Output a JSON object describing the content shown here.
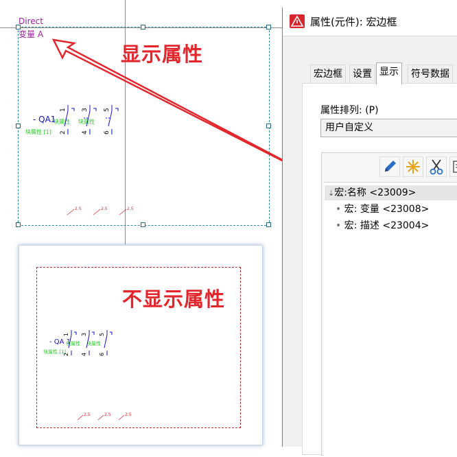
{
  "canvas": {
    "direct_label": "Direct",
    "variant_label": "变量 A",
    "annotation_show": "显示属性",
    "annotation_hide": "不显示属性",
    "device_tag": "- QA1",
    "device_tag2": "- QA 1",
    "attr_text_a": "块属性",
    "attr_text_b": "块属性",
    "attr_text_c": "块属性 [1]",
    "pin_numbers": [
      "1",
      "3",
      "5"
    ],
    "pin_numbers_bottom": [
      "2",
      "4",
      "6"
    ],
    "wire_size": "2.5"
  },
  "dialog": {
    "title": "属性(元件): 宏边框",
    "tabs": [
      {
        "label": "宏边框",
        "active": false
      },
      {
        "label": "设置",
        "active": false
      },
      {
        "label": "显示",
        "active": true
      },
      {
        "label": "符号数据",
        "active": false
      }
    ],
    "attr_order_label": "属性排列: (P)",
    "attr_order_value": "用户自定义",
    "toolbar": [
      "pencil-icon",
      "star-burst-icon",
      "scissors-icon",
      "copy-icon"
    ],
    "list": [
      {
        "text": "宏:名称 <23009>",
        "selected": true
      },
      {
        "text": "宏: 变量 <23008>",
        "selected": false
      },
      {
        "text": "宏: 描述 <23004>",
        "selected": false
      }
    ]
  },
  "colors": {
    "annotation": "#e3262c",
    "purple_text": "#a020a0",
    "blue_text": "#1010d0",
    "green_text": "#22cc22",
    "selection": "#2b8aa0"
  }
}
